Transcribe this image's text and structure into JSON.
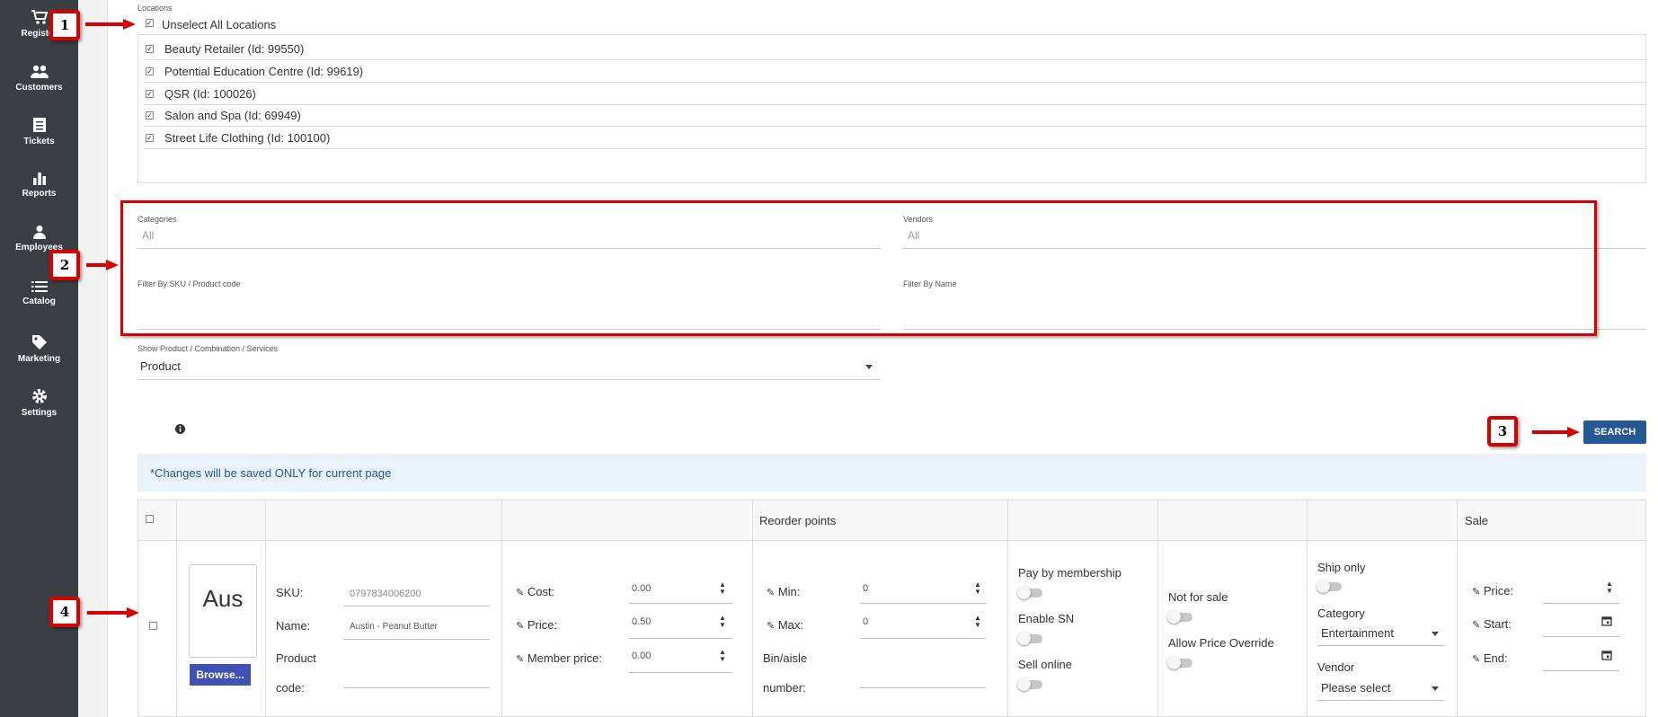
{
  "sidebar": {
    "items": [
      {
        "label": "Register",
        "icon": "cart-icon"
      },
      {
        "label": "Customers",
        "icon": "people-icon"
      },
      {
        "label": "Tickets",
        "icon": "receipt-icon"
      },
      {
        "label": "Reports",
        "icon": "bar-chart-icon"
      },
      {
        "label": "Employees",
        "icon": "person-icon"
      },
      {
        "label": "Catalog",
        "icon": "list-icon"
      },
      {
        "label": "Marketing",
        "icon": "tag-icon"
      },
      {
        "label": "Settings",
        "icon": "gear-icon"
      }
    ]
  },
  "locations": {
    "label": "Locations",
    "toggle_all": "Unselect All Locations",
    "items": [
      "Beauty Retailer (Id: 99550)",
      "Potential Education Centre (Id: 99619)",
      "QSR (Id: 100026)",
      "Salon and Spa (Id: 69949)",
      "Street Life Clothing (Id: 100100)"
    ]
  },
  "filters": {
    "categories_label": "Categories",
    "categories_value": "All",
    "vendors_label": "Vendors",
    "vendors_value": "All",
    "sku_label": "Filter By SKU / Product code",
    "name_label": "Filter By Name",
    "show_label": "Show Product / Combination / Services",
    "show_value": "Product"
  },
  "search_label": "SEARCH",
  "notice": "*Changes will be saved ONLY for current page",
  "table": {
    "header_reorder": "Reorder points",
    "header_sale": "Sale",
    "thumb_text": "Aus",
    "browse_label": "Browse...",
    "sku_label": "SKU:",
    "sku_value": "0797834006200",
    "name_label": "Name:",
    "name_value": "Austin - Peanut Butter",
    "product_code_label_1": "Product",
    "product_code_label_2": "code:",
    "cost_label": "Cost:",
    "cost_value": "0.00",
    "price_label": "Price:",
    "price_value": "0.50",
    "member_price_label": "Member price:",
    "member_price_value": "0.00",
    "min_label": "Min:",
    "min_value": "0",
    "max_label": "Max:",
    "max_value": "0",
    "bin_label_1": "Bin/aisle",
    "bin_label_2": "number:",
    "pay_membership": "Pay by membership",
    "enable_sn": "Enable SN",
    "sell_online": "Sell online",
    "not_for_sale": "Not for sale",
    "allow_price_override": "Allow Price Override",
    "ship_only": "Ship only",
    "category_label": "Category",
    "category_value": "Entertainment",
    "vendor_label": "Vendor",
    "vendor_value": "Please select",
    "sale_price_label": "Price:",
    "sale_start_label": "Start:",
    "sale_end_label": "End:"
  },
  "callouts": [
    "1",
    "2",
    "3",
    "4"
  ],
  "colors": {
    "sidebar": "#3a3f44",
    "accent": "#265894",
    "callout_red": "#d80000",
    "browse": "#3f51b5"
  }
}
